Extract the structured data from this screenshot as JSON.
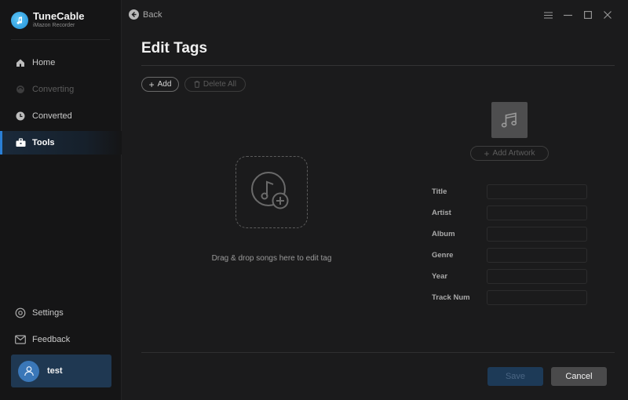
{
  "brand": {
    "name": "TuneCable",
    "subtitle": "iMazon Recorder"
  },
  "sidebar": {
    "items": [
      {
        "label": "Home",
        "icon": "home-icon",
        "state": "normal"
      },
      {
        "label": "Converting",
        "icon": "converting-icon",
        "state": "disabled"
      },
      {
        "label": "Converted",
        "icon": "clock-icon",
        "state": "normal"
      },
      {
        "label": "Tools",
        "icon": "toolbox-icon",
        "state": "active"
      }
    ],
    "bottom_items": [
      {
        "label": "Settings",
        "icon": "gear-icon"
      },
      {
        "label": "Feedback",
        "icon": "mail-icon"
      }
    ],
    "user": {
      "name": "test"
    }
  },
  "topbar": {
    "back_label": "Back"
  },
  "main": {
    "title": "Edit Tags",
    "add_label": "Add",
    "delete_all_label": "Delete All",
    "drop_text": "Drag & drop songs here to edit tag",
    "add_artwork_label": "Add Artwork",
    "fields": [
      {
        "label": "Title",
        "value": ""
      },
      {
        "label": "Artist",
        "value": ""
      },
      {
        "label": "Album",
        "value": ""
      },
      {
        "label": "Genre",
        "value": ""
      },
      {
        "label": "Year",
        "value": ""
      },
      {
        "label": "Track Num",
        "value": ""
      }
    ],
    "save_label": "Save",
    "cancel_label": "Cancel"
  },
  "colors": {
    "accent": "#2a7fd6",
    "save_bg": "#1d3a57",
    "cancel_bg": "#4a4a4b"
  }
}
